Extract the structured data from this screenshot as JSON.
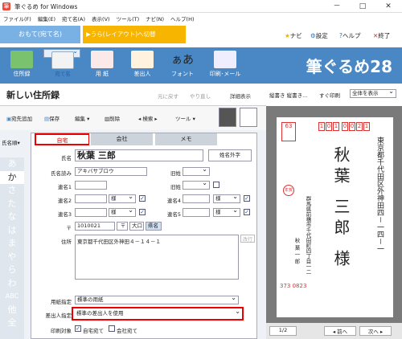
{
  "app": {
    "title": "筆ぐるめ for Windows",
    "icon": "筆",
    "min": "－",
    "max": "□",
    "close": "✕"
  },
  "menu": [
    "ファイル(F)",
    "編集(E)",
    "宛て名(A)",
    "表示(V)",
    "ツール(T)",
    "ナビ(N)",
    "ヘルプ(H)"
  ],
  "mode": {
    "omote": "おもて(宛て名)",
    "ura": "▶うら(レイアウト)へ切替",
    "navi": "ナビ",
    "settings": "設定",
    "help": "ヘルプ",
    "quit": "終了"
  },
  "ribbon": {
    "items": [
      "住所録",
      "宛て名",
      "用 紙",
      "差出人",
      "フォント",
      "印刷･メール"
    ],
    "brand": "筆ぐるめ28",
    "font_glyph": "ぁあ"
  },
  "header": {
    "title": "新しい住所録",
    "undo": "元に戻す",
    "redo": "やり直し",
    "detail": "詳細表示"
  },
  "toolbar": {
    "add": "宛先追加",
    "save": "保存",
    "edit": "編集",
    "delete": "削除",
    "search": "検索",
    "tool": "ツール"
  },
  "sort": {
    "label": "氏名順",
    "chevron": "▾"
  },
  "kana": [
    "あ",
    "か",
    "さ",
    "た",
    "な",
    "は",
    "ま",
    "や",
    "ら",
    "わ",
    "ABC",
    "他",
    "全"
  ],
  "tabs": {
    "home": "自宅",
    "company": "会社",
    "memo": "メモ"
  },
  "form": {
    "name_label": "氏名",
    "name_value": "秋葉 三郎",
    "gaiji": "姓名外字",
    "yomi_label": "氏名読み",
    "yomi_value": "アキバサブロウ",
    "kyuusei": "旧姓",
    "rensei1": "連名1",
    "rensei2": "連名2",
    "rensei3": "連名3",
    "rensei4": "連名4",
    "rensei5": "連名5",
    "sama": "様",
    "zip_mark": "〒",
    "zip_value": "1010021",
    "zip_btn1": "〒",
    "zip_btn2": "大口",
    "zip_btn3": "県名",
    "addr_label": "住所",
    "addr_value": "東京都千代田区外神田４－１４－１",
    "kaigyo": "改行",
    "paper_label": "用紙指定",
    "paper_value": "標準の用紙",
    "sender_label": "差出人指定",
    "sender_value": "標準の差出人を使用",
    "print_label": "印刷対象",
    "home_check": "自宅宛て",
    "company_check": "会社宛て",
    "check": "✓"
  },
  "preview": {
    "mode": "縦書き 縦書き...",
    "fit": "すぐ印刷",
    "zoom": "全体を表示",
    "zip": [
      "1",
      "0",
      "1",
      "0",
      "0",
      "2",
      "1"
    ],
    "addr": "東京都千代田区外神田四－一四－一",
    "name": "秋葉 三郎 様",
    "sender_addr": "群馬県前橋市千代田町四丁目一二",
    "sender_name": "秋 葉 一 郎",
    "sender_zip": "373 0823",
    "page": "1/2",
    "prev": "前へ",
    "next": "次へ",
    "postage": "63",
    "stamp_label": "年賀"
  }
}
